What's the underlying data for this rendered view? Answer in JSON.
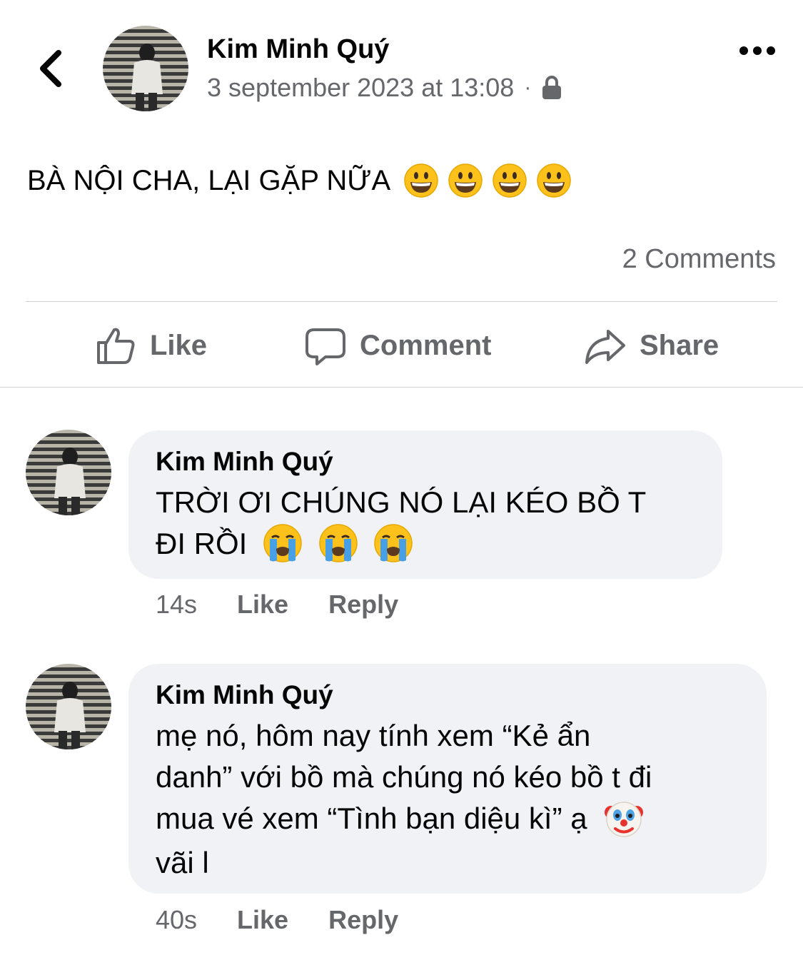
{
  "post": {
    "author": "Kim Minh Quý",
    "timestamp": "3 september 2023 at 13:08",
    "separator": "·",
    "privacy_icon": "lock-icon",
    "text": "BÀ NỘI CHA, LẠI GẶP NỮA",
    "text_emojis": [
      "grinning-face",
      "grinning-face",
      "grinning-face",
      "grinning-face"
    ],
    "comments_count": "2 Comments"
  },
  "actions": {
    "like": "Like",
    "comment": "Comment",
    "share": "Share"
  },
  "comments": [
    {
      "author": "Kim Minh Quý",
      "line1": "TRỜI ƠI CHÚNG NÓ LẠI KÉO BỒ T",
      "line2": "ĐI RỒI",
      "emojis": [
        "loudly-crying-face",
        "loudly-crying-face",
        "loudly-crying-face"
      ],
      "time": "14s",
      "like": "Like",
      "reply": "Reply"
    },
    {
      "author": "Kim Minh Quý",
      "line1": "mẹ nó, hôm nay tính xem “Kẻ ẩn",
      "line2": "danh” với bồ mà chúng nó kéo bồ t đi",
      "line3": "mua vé xem “Tình bạn diệu kì” ạ",
      "line4": "vãi l",
      "emojis": [
        "clown-face"
      ],
      "time": "40s",
      "like": "Like",
      "reply": "Reply"
    }
  ],
  "colors": {
    "text": "#050505",
    "secondary": "#65676b",
    "bubble": "#f0f2f5",
    "divider": "#ced0d4"
  }
}
